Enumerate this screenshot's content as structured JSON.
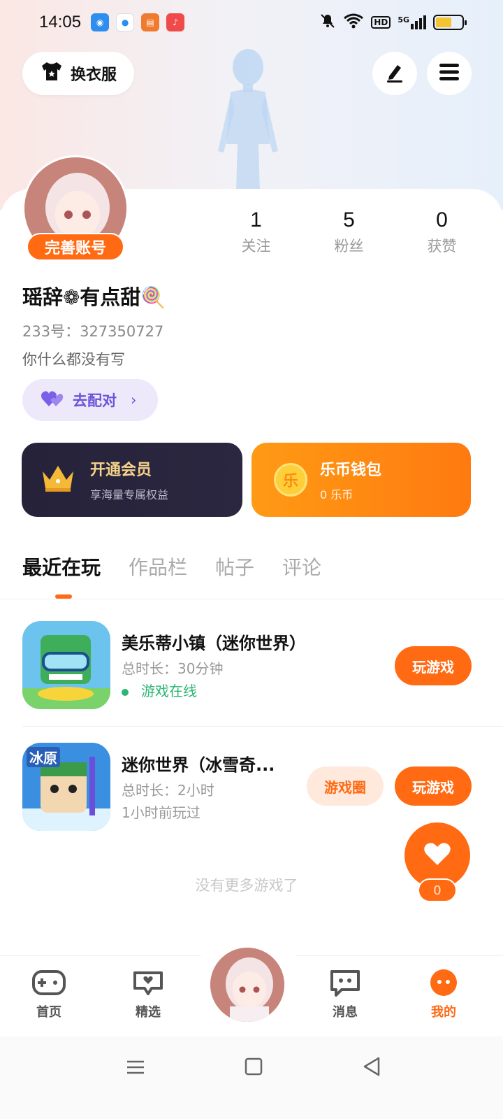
{
  "status_bar": {
    "time": "14:05",
    "network": "5G",
    "hd": "HD"
  },
  "header": {
    "dress_label": "换衣服"
  },
  "profile": {
    "badge": "完善账号",
    "username": "瑶辞❁有点甜🍭",
    "uid": "233号：327350727",
    "bio": "你什么都没有写",
    "match_label": "去配对",
    "stats": [
      {
        "value": "1",
        "label": "关注"
      },
      {
        "value": "5",
        "label": "粉丝"
      },
      {
        "value": "0",
        "label": "获赞"
      }
    ]
  },
  "promos": {
    "vip": {
      "title": "开通会员",
      "subtitle": "享海量专属权益"
    },
    "wallet": {
      "title": "乐币钱包",
      "subtitle": "0 乐币",
      "coin_char": "乐"
    }
  },
  "tabs": [
    "最近在玩",
    "作品栏",
    "帖子",
    "评论"
  ],
  "games": [
    {
      "title": "美乐蒂小镇（迷你世界）",
      "duration": "总时长：30分钟",
      "status": "游戏在线",
      "play_label": "玩游戏"
    },
    {
      "title": "迷你世界（冰雪奇...",
      "duration": "总时长：2小时",
      "status": "1小时前玩过",
      "circle_label": "游戏圈",
      "play_label": "玩游戏",
      "icon_text": "冰原"
    }
  ],
  "no_more": "没有更多游戏了",
  "like_count": "0",
  "bottom_nav": [
    {
      "label": "首页",
      "icon": "gamepad-icon"
    },
    {
      "label": "精选",
      "icon": "heart-chat-icon"
    },
    {
      "label": "消息",
      "icon": "chat-icon"
    },
    {
      "label": "我的",
      "icon": "profile-face-icon"
    }
  ],
  "colors": {
    "accent": "#ff6a13",
    "match": "#6a55d8",
    "online": "#2bb673",
    "vip_bg": "#26223a"
  }
}
